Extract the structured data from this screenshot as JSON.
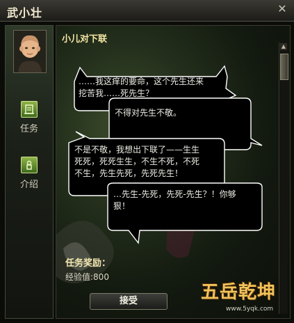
{
  "window": {
    "title": "武小壮",
    "close_icon": "close-x-icon"
  },
  "sidebar": {
    "portrait": "npc-portrait-icon",
    "items": [
      {
        "label": "任务",
        "icon": "quest-icon"
      },
      {
        "label": "介绍",
        "icon": "info-icon"
      }
    ]
  },
  "dialog": {
    "heading": "小儿对下联",
    "bubbles": [
      {
        "lines": [
          "……我这痒的要命，这个先生还来",
          "挖苦我……死先生？"
        ]
      },
      {
        "lines": [
          "不得对先生不敬。"
        ]
      },
      {
        "lines": [
          "不是不敬，我想出下联了——生生",
          "死死，死死生生，不生不死，不死",
          "不生，先生先死，先死先生！"
        ]
      },
      {
        "lines": [
          "…先生-先死，先死-先生？！你够",
          "狠！"
        ]
      }
    ]
  },
  "reward": {
    "title": "任务奖励：",
    "exp": "经验值:800"
  },
  "accept_button": "接受",
  "logo": {
    "main": "五岳乾坤",
    "sub": "www.5yqk.com"
  },
  "colors": {
    "heading": "#f4e6a6",
    "bubble_fill": "#000000",
    "bubble_border": "#ffffff",
    "nav_icon": "#6b9a34"
  }
}
